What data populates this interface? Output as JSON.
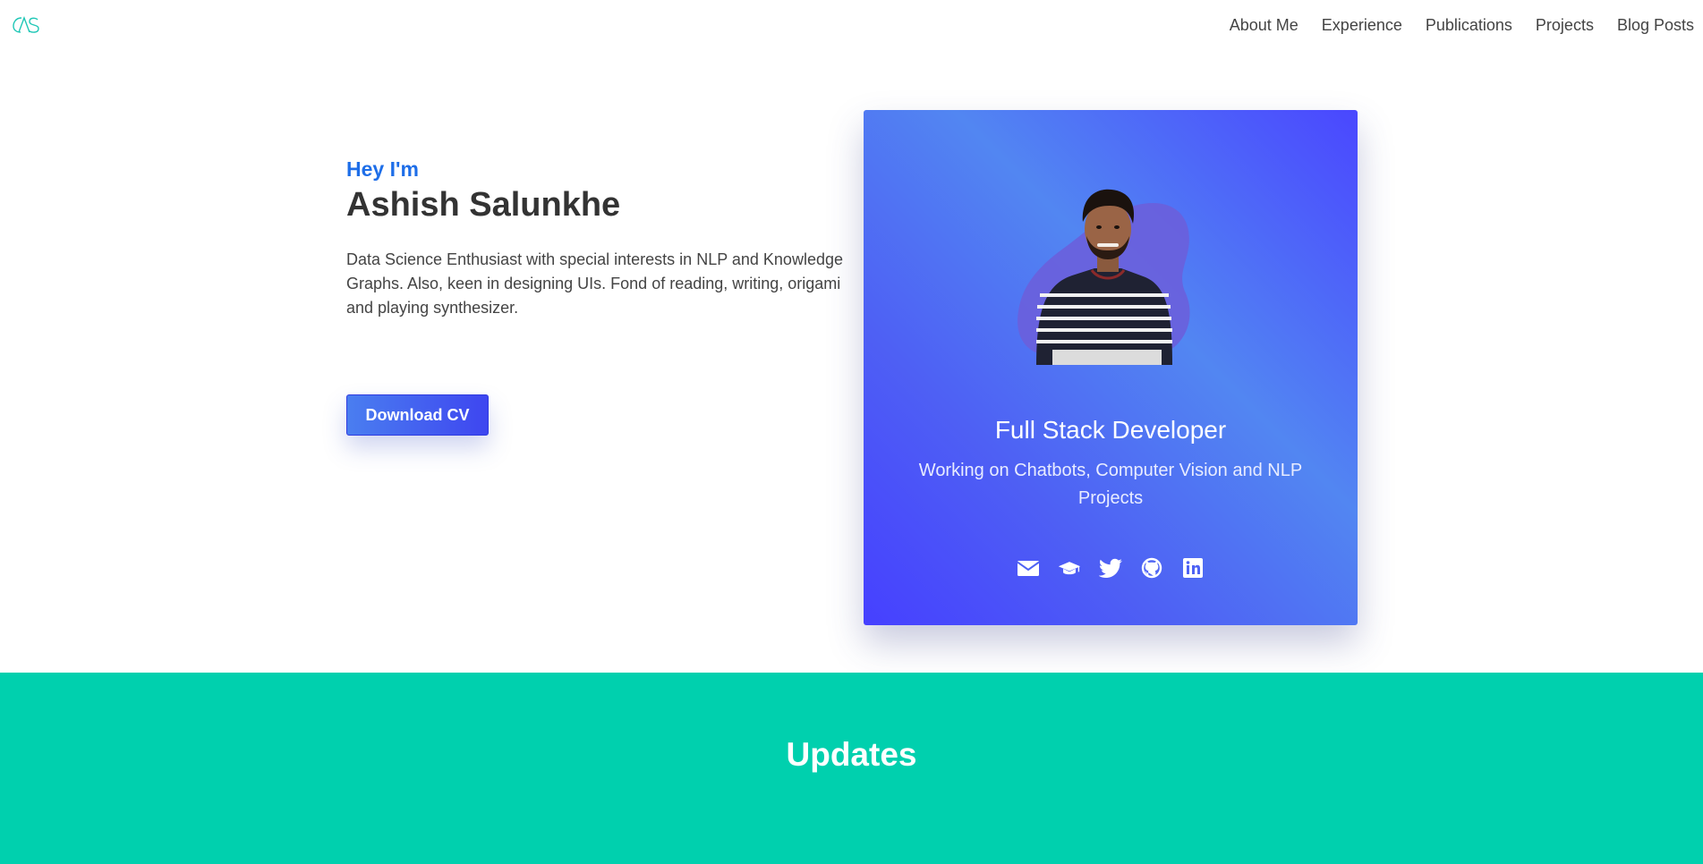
{
  "header": {
    "logo_icon": "as-monogram-logo-icon",
    "nav": [
      "About Me",
      "Experience",
      "Publications",
      "Projects",
      "Blog Posts"
    ]
  },
  "hero": {
    "greeting": "Hey I'm",
    "name": "Ashish Salunkhe",
    "bio": "Data Science Enthusiast with special interests in NLP and Knowledge Graphs. Also, keen in designing UIs. Fond of reading, writing, origami and playing synthesizer.",
    "cta_label": "Download CV"
  },
  "card": {
    "title": "Full Stack Developer",
    "subtitle": "Working on Chatbots, Computer Vision and NLP Projects",
    "social_icons": [
      "envelope-icon",
      "graduation-cap-icon",
      "twitter-icon",
      "github-icon",
      "linkedin-icon"
    ]
  },
  "updates": {
    "title": "Updates"
  },
  "colors": {
    "accent": "#1e6ee8",
    "card_gradient_start": "#5286f2",
    "card_gradient_end": "#4640ff",
    "updates_bg": "#00d0ae",
    "logo": "#1fc7b6"
  }
}
